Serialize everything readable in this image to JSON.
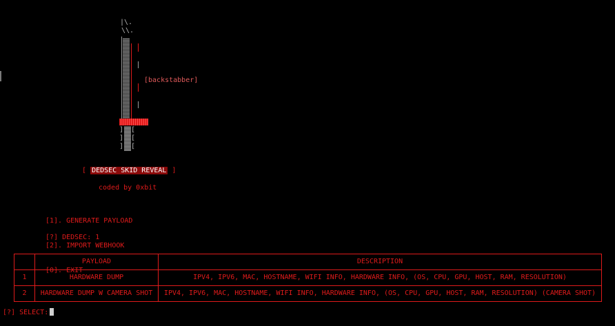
{
  "app": {
    "knife_label": "[backstabber]",
    "title_open": "[",
    "title": "DEDSEC SKID REVEAL",
    "title_close": "]",
    "credit": "coded by 0xbit"
  },
  "menu": {
    "items": [
      "[1]. GENERATE PAYLOAD",
      "[2]. IMPORT WEBHOOK",
      "[0]. EXIT"
    ]
  },
  "prompt_dedsec": "[?] DEDSEC: 1",
  "table": {
    "headers": [
      "",
      "PAYLOAD",
      "DESCRIPTION"
    ],
    "rows": [
      {
        "num": "1",
        "payload": "HARDWARE DUMP",
        "description": "IPV4, IPV6, MAC, HOSTNAME, WIFI INFO, HARDWARE INFO, (OS, CPU, GPU, HOST, RAM, RESOLUTION)"
      },
      {
        "num": "2",
        "payload": "HARDWARE DUMP W CAMERA SHOT",
        "description": "IPV4, IPV6, MAC, HOSTNAME, WIFI INFO, HARDWARE INFO, (OS, CPU, GPU, HOST, RAM, RESOLUTION) (CAMERA SHOT)"
      }
    ]
  },
  "prompt_select": "[?] SELECT:",
  "colors": {
    "accent": "#e01b1b",
    "badge_bg": "#8b0a0a",
    "background": "#000000"
  }
}
